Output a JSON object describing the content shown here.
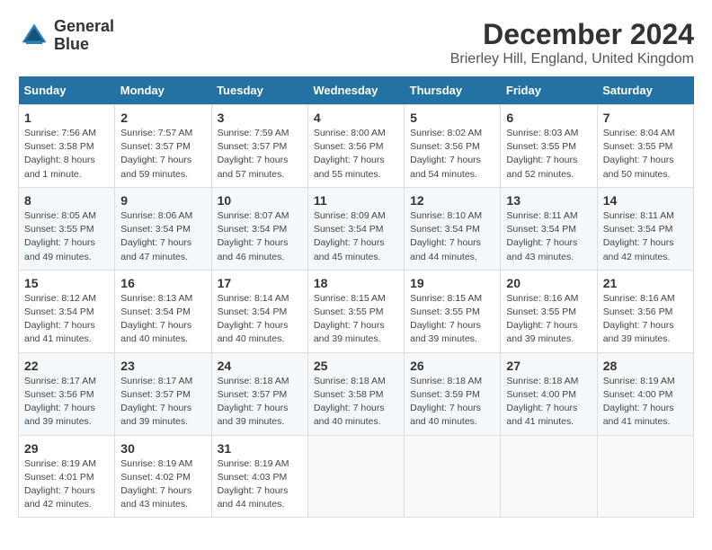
{
  "logo": {
    "line1": "General",
    "line2": "Blue"
  },
  "title": "December 2024",
  "subtitle": "Brierley Hill, England, United Kingdom",
  "headers": [
    "Sunday",
    "Monday",
    "Tuesday",
    "Wednesday",
    "Thursday",
    "Friday",
    "Saturday"
  ],
  "weeks": [
    [
      {
        "day": "1",
        "sunrise": "Sunrise: 7:56 AM",
        "sunset": "Sunset: 3:58 PM",
        "daylight": "Daylight: 8 hours and 1 minute."
      },
      {
        "day": "2",
        "sunrise": "Sunrise: 7:57 AM",
        "sunset": "Sunset: 3:57 PM",
        "daylight": "Daylight: 7 hours and 59 minutes."
      },
      {
        "day": "3",
        "sunrise": "Sunrise: 7:59 AM",
        "sunset": "Sunset: 3:57 PM",
        "daylight": "Daylight: 7 hours and 57 minutes."
      },
      {
        "day": "4",
        "sunrise": "Sunrise: 8:00 AM",
        "sunset": "Sunset: 3:56 PM",
        "daylight": "Daylight: 7 hours and 55 minutes."
      },
      {
        "day": "5",
        "sunrise": "Sunrise: 8:02 AM",
        "sunset": "Sunset: 3:56 PM",
        "daylight": "Daylight: 7 hours and 54 minutes."
      },
      {
        "day": "6",
        "sunrise": "Sunrise: 8:03 AM",
        "sunset": "Sunset: 3:55 PM",
        "daylight": "Daylight: 7 hours and 52 minutes."
      },
      {
        "day": "7",
        "sunrise": "Sunrise: 8:04 AM",
        "sunset": "Sunset: 3:55 PM",
        "daylight": "Daylight: 7 hours and 50 minutes."
      }
    ],
    [
      {
        "day": "8",
        "sunrise": "Sunrise: 8:05 AM",
        "sunset": "Sunset: 3:55 PM",
        "daylight": "Daylight: 7 hours and 49 minutes."
      },
      {
        "day": "9",
        "sunrise": "Sunrise: 8:06 AM",
        "sunset": "Sunset: 3:54 PM",
        "daylight": "Daylight: 7 hours and 47 minutes."
      },
      {
        "day": "10",
        "sunrise": "Sunrise: 8:07 AM",
        "sunset": "Sunset: 3:54 PM",
        "daylight": "Daylight: 7 hours and 46 minutes."
      },
      {
        "day": "11",
        "sunrise": "Sunrise: 8:09 AM",
        "sunset": "Sunset: 3:54 PM",
        "daylight": "Daylight: 7 hours and 45 minutes."
      },
      {
        "day": "12",
        "sunrise": "Sunrise: 8:10 AM",
        "sunset": "Sunset: 3:54 PM",
        "daylight": "Daylight: 7 hours and 44 minutes."
      },
      {
        "day": "13",
        "sunrise": "Sunrise: 8:11 AM",
        "sunset": "Sunset: 3:54 PM",
        "daylight": "Daylight: 7 hours and 43 minutes."
      },
      {
        "day": "14",
        "sunrise": "Sunrise: 8:11 AM",
        "sunset": "Sunset: 3:54 PM",
        "daylight": "Daylight: 7 hours and 42 minutes."
      }
    ],
    [
      {
        "day": "15",
        "sunrise": "Sunrise: 8:12 AM",
        "sunset": "Sunset: 3:54 PM",
        "daylight": "Daylight: 7 hours and 41 minutes."
      },
      {
        "day": "16",
        "sunrise": "Sunrise: 8:13 AM",
        "sunset": "Sunset: 3:54 PM",
        "daylight": "Daylight: 7 hours and 40 minutes."
      },
      {
        "day": "17",
        "sunrise": "Sunrise: 8:14 AM",
        "sunset": "Sunset: 3:54 PM",
        "daylight": "Daylight: 7 hours and 40 minutes."
      },
      {
        "day": "18",
        "sunrise": "Sunrise: 8:15 AM",
        "sunset": "Sunset: 3:55 PM",
        "daylight": "Daylight: 7 hours and 39 minutes."
      },
      {
        "day": "19",
        "sunrise": "Sunrise: 8:15 AM",
        "sunset": "Sunset: 3:55 PM",
        "daylight": "Daylight: 7 hours and 39 minutes."
      },
      {
        "day": "20",
        "sunrise": "Sunrise: 8:16 AM",
        "sunset": "Sunset: 3:55 PM",
        "daylight": "Daylight: 7 hours and 39 minutes."
      },
      {
        "day": "21",
        "sunrise": "Sunrise: 8:16 AM",
        "sunset": "Sunset: 3:56 PM",
        "daylight": "Daylight: 7 hours and 39 minutes."
      }
    ],
    [
      {
        "day": "22",
        "sunrise": "Sunrise: 8:17 AM",
        "sunset": "Sunset: 3:56 PM",
        "daylight": "Daylight: 7 hours and 39 minutes."
      },
      {
        "day": "23",
        "sunrise": "Sunrise: 8:17 AM",
        "sunset": "Sunset: 3:57 PM",
        "daylight": "Daylight: 7 hours and 39 minutes."
      },
      {
        "day": "24",
        "sunrise": "Sunrise: 8:18 AM",
        "sunset": "Sunset: 3:57 PM",
        "daylight": "Daylight: 7 hours and 39 minutes."
      },
      {
        "day": "25",
        "sunrise": "Sunrise: 8:18 AM",
        "sunset": "Sunset: 3:58 PM",
        "daylight": "Daylight: 7 hours and 40 minutes."
      },
      {
        "day": "26",
        "sunrise": "Sunrise: 8:18 AM",
        "sunset": "Sunset: 3:59 PM",
        "daylight": "Daylight: 7 hours and 40 minutes."
      },
      {
        "day": "27",
        "sunrise": "Sunrise: 8:18 AM",
        "sunset": "Sunset: 4:00 PM",
        "daylight": "Daylight: 7 hours and 41 minutes."
      },
      {
        "day": "28",
        "sunrise": "Sunrise: 8:19 AM",
        "sunset": "Sunset: 4:00 PM",
        "daylight": "Daylight: 7 hours and 41 minutes."
      }
    ],
    [
      {
        "day": "29",
        "sunrise": "Sunrise: 8:19 AM",
        "sunset": "Sunset: 4:01 PM",
        "daylight": "Daylight: 7 hours and 42 minutes."
      },
      {
        "day": "30",
        "sunrise": "Sunrise: 8:19 AM",
        "sunset": "Sunset: 4:02 PM",
        "daylight": "Daylight: 7 hours and 43 minutes."
      },
      {
        "day": "31",
        "sunrise": "Sunrise: 8:19 AM",
        "sunset": "Sunset: 4:03 PM",
        "daylight": "Daylight: 7 hours and 44 minutes."
      },
      null,
      null,
      null,
      null
    ]
  ]
}
